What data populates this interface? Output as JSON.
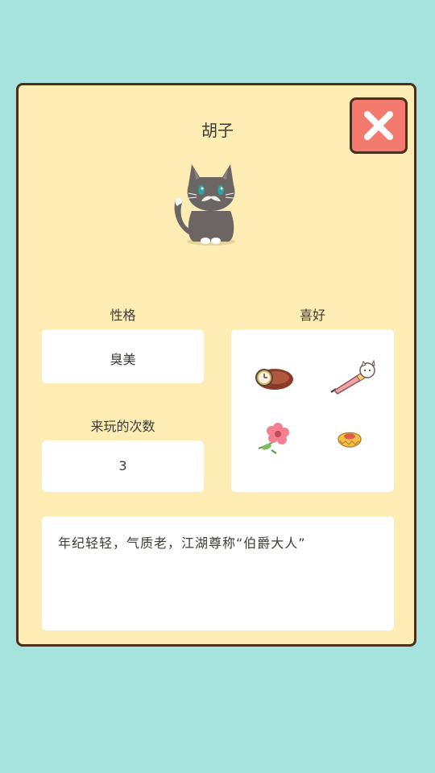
{
  "cat": {
    "name": "胡子",
    "description": "年纪轻轻，气质老，江湖尊称“伯爵大人”"
  },
  "personality": {
    "label": "性格",
    "value": "臭美"
  },
  "visits": {
    "label": "来玩的次数",
    "value": "3"
  },
  "favorites": {
    "label": "喜好",
    "items": [
      "wristwatch-icon",
      "cat-pen-icon",
      "flower-icon",
      "cookie-icon"
    ]
  },
  "colors": {
    "background": "#a6e2de",
    "panel": "#fdedb4",
    "close_button": "#f47a6f",
    "border": "#4a2f1a"
  },
  "icons": {
    "close": "close-icon",
    "cat": "gray-cat-with-mustache"
  }
}
